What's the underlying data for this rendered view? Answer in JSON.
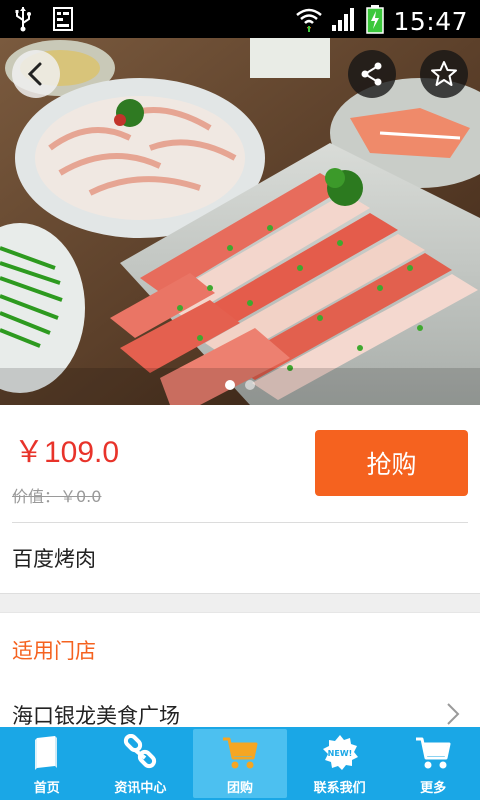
{
  "status_bar": {
    "time": "15:47",
    "icons": [
      "usb-icon",
      "keyboard-icon",
      "wifi-icon",
      "signal-icon",
      "battery-icon"
    ]
  },
  "hero": {
    "carousel_total": 2,
    "carousel_active": 1
  },
  "product": {
    "price": "￥109.0",
    "original_price": "价值：￥0.0",
    "buy_label": "抢购",
    "name": "百度烤肉"
  },
  "stores": {
    "title": "适用门店",
    "items": [
      {
        "name": "海口银龙美食广场"
      }
    ]
  },
  "nav": {
    "items": [
      {
        "label": "首页",
        "icon": "book-icon"
      },
      {
        "label": "资讯中心",
        "icon": "chain-link-icon"
      },
      {
        "label": "团购",
        "icon": "cart-icon",
        "active": true
      },
      {
        "label": "联系我们",
        "icon": "new-badge-icon"
      },
      {
        "label": "更多",
        "icon": "cart-more-icon"
      }
    ]
  },
  "colors": {
    "accent": "#f5621f",
    "price": "#e8332a",
    "nav_bg": "#1aa7e6",
    "nav_active": "#4cc0f0"
  }
}
